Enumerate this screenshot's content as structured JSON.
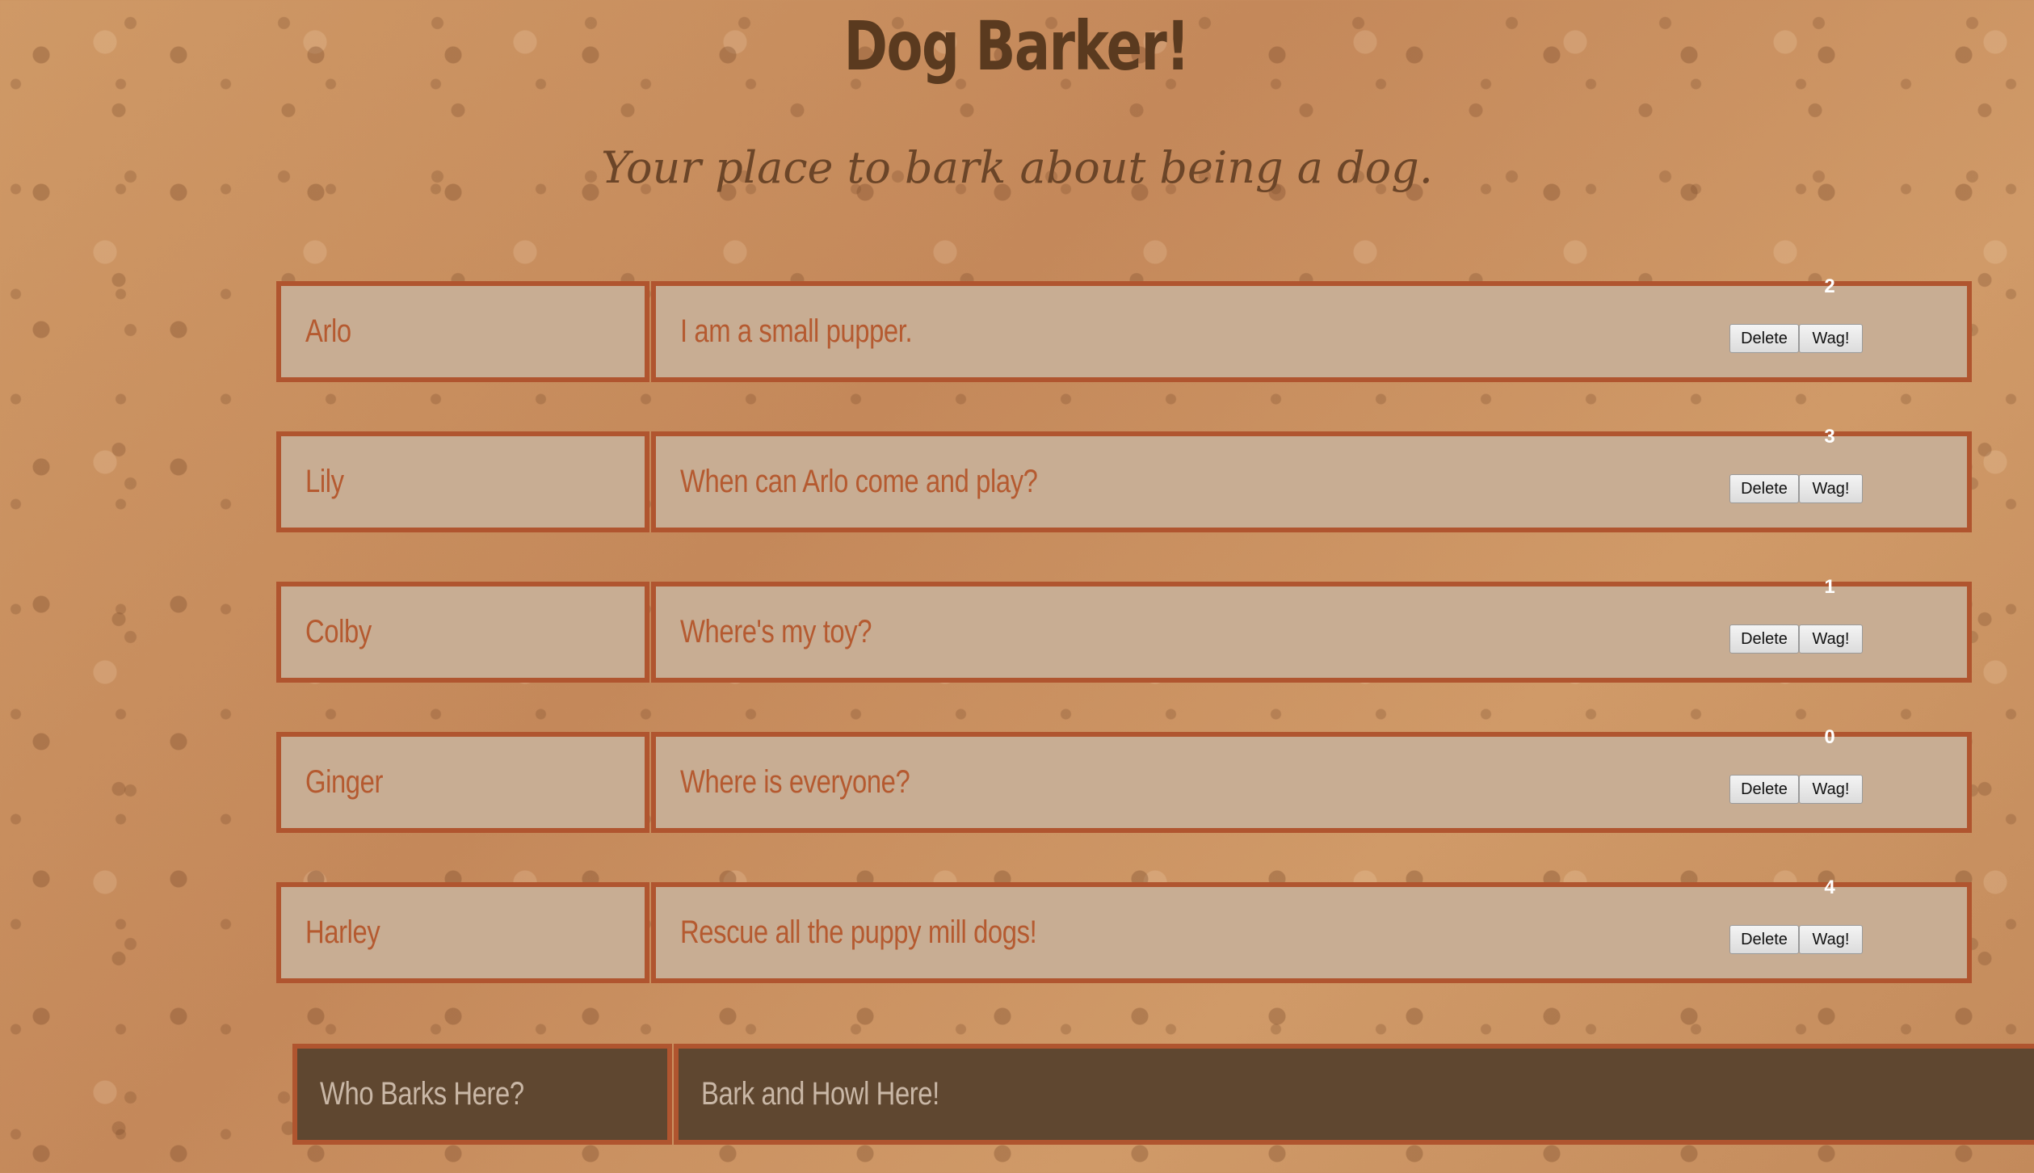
{
  "header": {
    "title": "Dog Barker!",
    "subtitle": "Your place to bark about being a dog."
  },
  "barks": [
    {
      "name": "Arlo",
      "message": "I am a small pupper.",
      "wags": "2",
      "delete_label": "Delete",
      "wag_label": "Wag!"
    },
    {
      "name": "Lily",
      "message": "When can Arlo come and play?",
      "wags": "3",
      "delete_label": "Delete",
      "wag_label": "Wag!"
    },
    {
      "name": "Colby",
      "message": "Where's my toy?",
      "wags": "1",
      "delete_label": "Delete",
      "wag_label": "Wag!"
    },
    {
      "name": "Ginger",
      "message": "Where is everyone?",
      "wags": "0",
      "delete_label": "Delete",
      "wag_label": "Wag!"
    },
    {
      "name": "Harley",
      "message": "Rescue all the puppy mill dogs!",
      "wags": "4",
      "delete_label": "Delete",
      "wag_label": "Wag!"
    }
  ],
  "form": {
    "name_placeholder": "Who Barks Here?",
    "message_placeholder": "Bark and Howl Here!"
  },
  "colors": {
    "title": "#5a3a1f",
    "box_fill": "#c8ad93",
    "box_border": "#b0552f",
    "box_text": "#b55a30",
    "form_fill": "#5f4730",
    "form_text": "#c9b7a6"
  }
}
